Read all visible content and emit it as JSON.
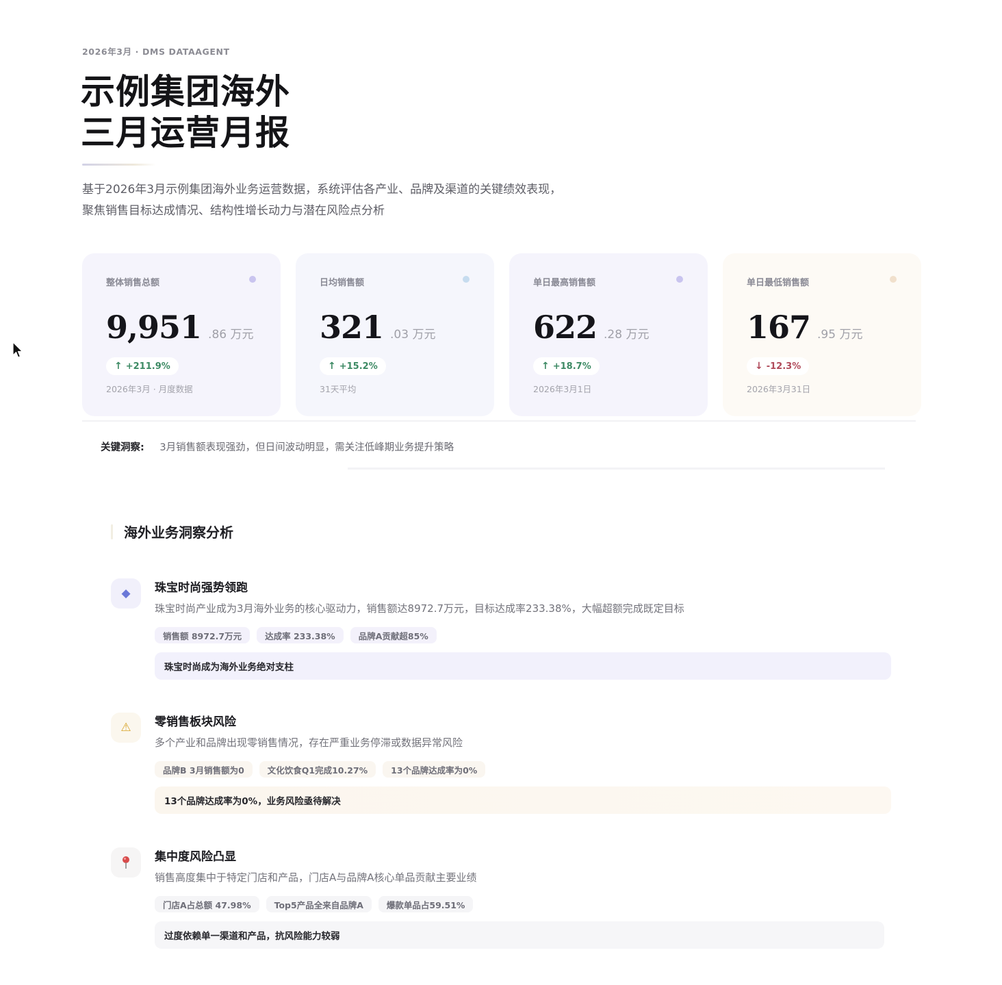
{
  "header": {
    "eyebrow": "2026年3月 · DMS DATAAGENT",
    "title_line1": "示例集团海外",
    "title_line2": "三月运营月报",
    "intro_line1": "基于2026年3月示例集团海外业务运营数据，系统评估各产业、品牌及渠道的关键绩效表现，",
    "intro_line2": "聚焦销售目标达成情况、结构性增长动力与潜在风险点分析"
  },
  "cards": [
    {
      "label": "整体销售总额",
      "value": "9,951",
      "decimal": ".86 万元",
      "trend": "up",
      "arrow": "↑",
      "change": "+211.9%",
      "sub": "2026年3月 · 月度数据",
      "dot_color": "#c9c4ef"
    },
    {
      "label": "日均销售额",
      "value": "321",
      "decimal": ".03 万元",
      "trend": "up",
      "arrow": "↑",
      "change": "+15.2%",
      "sub": "31天平均",
      "dot_color": "#c6dcef"
    },
    {
      "label": "单日最高销售额",
      "value": "622",
      "decimal": ".28 万元",
      "trend": "up",
      "arrow": "↑",
      "change": "+18.7%",
      "sub": "2026年3月1日",
      "dot_color": "#c9c4ef"
    },
    {
      "label": "单日最低销售额",
      "value": "167",
      "decimal": ".95 万元",
      "trend": "down",
      "arrow": "↓",
      "change": "-12.3%",
      "sub": "2026年3月31日",
      "dot_color": "#f1e0cc"
    }
  ],
  "insight": {
    "label": "关键洞察:",
    "text": "3月销售额表现强劲，但日间波动明显，需关注低峰期业务提升策略"
  },
  "section": {
    "title": "海外业务洞察分析"
  },
  "items": [
    {
      "icon": "diamond-icon",
      "glyph": "◆",
      "title": "珠宝时尚强势领跑",
      "desc": "珠宝时尚产业成为3月海外业务的核心驱动力，销售额达8972.7万元，目标达成率233.38%，大幅超额完成既定目标",
      "tags": [
        "销售额 8972.7万元",
        "达成率 233.38%",
        "品牌A贡献超85%"
      ],
      "note": "珠宝时尚成为海外业务绝对支柱"
    },
    {
      "icon": "warning-icon",
      "glyph": "⚠",
      "title": "零销售板块风险",
      "desc": "多个产业和品牌出现零销售情况，存在严重业务停滞或数据异常风险",
      "tags": [
        "品牌B 3月销售额为0",
        "文化饮食Q1完成10.27%",
        "13个品牌达成率为0%"
      ],
      "note": "13个品牌达成率为0%，业务风险亟待解决"
    },
    {
      "icon": "pushpin-icon",
      "glyph": "📍",
      "title": "集中度风险凸显",
      "desc": "销售高度集中于特定门店和产品，门店A与品牌A核心单品贡献主要业绩",
      "tags": [
        "门店A占总额 47.98%",
        "Top5产品全来自品牌A",
        "爆款单品占59.51%"
      ],
      "note": "过度依赖单一渠道和产品，抗风险能力较弱"
    }
  ]
}
